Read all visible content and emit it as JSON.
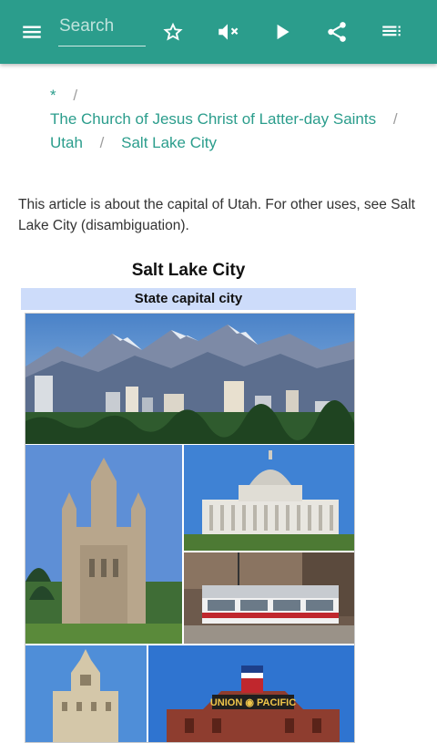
{
  "toolbar": {
    "search_placeholder": "Search",
    "icons": [
      "menu-icon",
      "star-outline-icon",
      "volume-off-icon",
      "play-icon",
      "share-icon",
      "list-icon"
    ]
  },
  "breadcrumb": {
    "items": [
      "*",
      "The Church of Jesus Christ of Latter-day Saints",
      "Utah",
      "Salt Lake City"
    ],
    "separator": "/"
  },
  "article": {
    "hatnote": "This article is about the capital of Utah. For other uses, see Salt Lake City (disambiguation)."
  },
  "infobox": {
    "title": "Salt Lake City",
    "subtitle": "State capital city"
  },
  "colors": {
    "accent": "#2b9d8c",
    "infobox_header": "#cddcfa"
  }
}
